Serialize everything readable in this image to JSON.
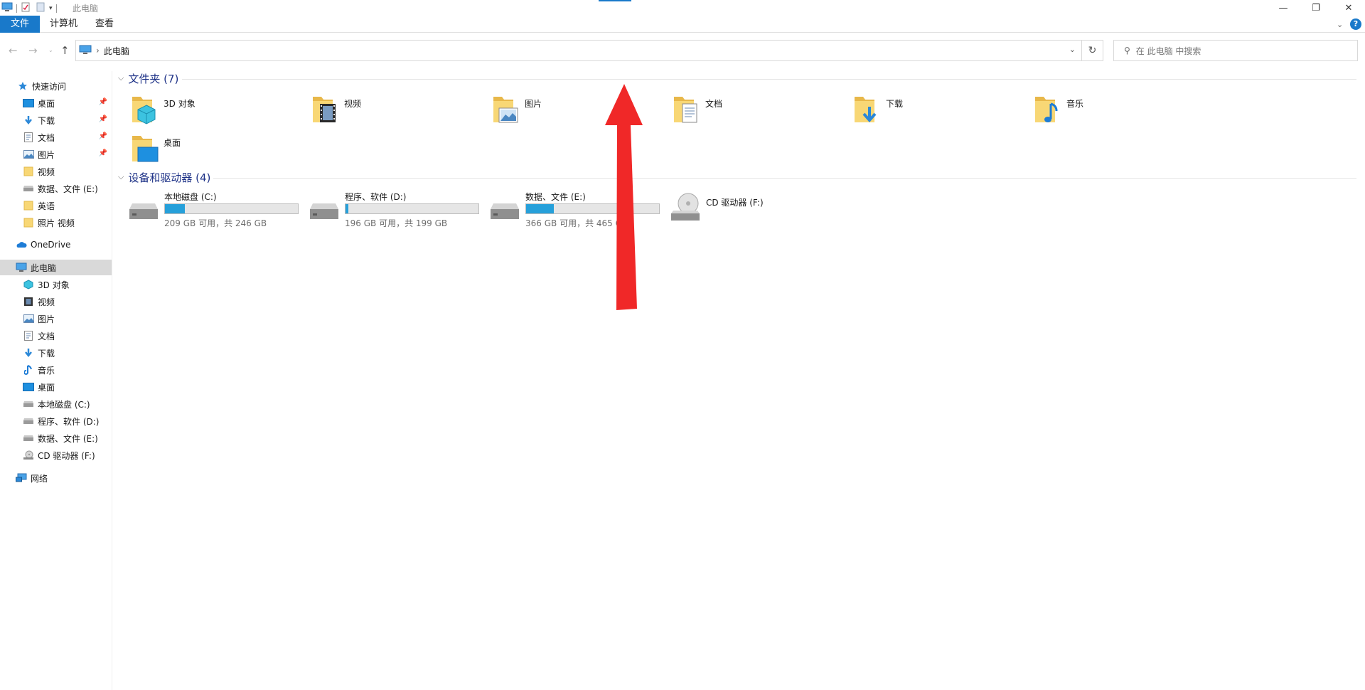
{
  "window": {
    "title": "此电脑",
    "controls": {
      "minimize": "—",
      "maximize": "❐",
      "close": "✕"
    }
  },
  "ribbon": {
    "tabs": [
      "文件",
      "计算机",
      "查看"
    ],
    "help": "?"
  },
  "address": {
    "path": "此电脑",
    "separator": "›",
    "search_placeholder": "在 此电脑 中搜索"
  },
  "nav": {
    "quick_access": "快速访问",
    "quick_items": [
      {
        "label": "桌面",
        "pinned": true
      },
      {
        "label": "下载",
        "pinned": true
      },
      {
        "label": "文档",
        "pinned": true
      },
      {
        "label": "图片",
        "pinned": true
      },
      {
        "label": "视频",
        "pinned": false
      },
      {
        "label": "数据、文件 (E:)",
        "pinned": false
      },
      {
        "label": "英语",
        "pinned": false
      },
      {
        "label": "照片 视频",
        "pinned": false
      }
    ],
    "onedrive": "OneDrive",
    "this_pc": "此电脑",
    "pc_items": [
      "3D 对象",
      "视频",
      "图片",
      "文档",
      "下载",
      "音乐",
      "桌面",
      "本地磁盘 (C:)",
      "程序、软件 (D:)",
      "数据、文件 (E:)",
      "CD 驱动器 (F:)"
    ],
    "network": "网络"
  },
  "content": {
    "folders_header": "文件夹 (7)",
    "folders": [
      "3D 对象",
      "视频",
      "图片",
      "文档",
      "下载",
      "音乐",
      "桌面"
    ],
    "devices_header": "设备和驱动器 (4)",
    "drives": [
      {
        "name": "本地磁盘 (C:)",
        "free": "209 GB 可用，共 246 GB",
        "used_fraction": 0.15
      },
      {
        "name": "程序、软件 (D:)",
        "free": "196 GB 可用，共 199 GB",
        "used_fraction": 0.02
      },
      {
        "name": "数据、文件 (E:)",
        "free": "366 GB 可用，共 465 G",
        "used_fraction": 0.21
      },
      {
        "name": "CD 驱动器 (F:)",
        "free": "",
        "used_fraction": null
      }
    ]
  },
  "colors": {
    "accent": "#1979ca",
    "group_header": "#1e3287",
    "drive_fill": "#26a0da",
    "annotation_arrow": "#f02828"
  }
}
